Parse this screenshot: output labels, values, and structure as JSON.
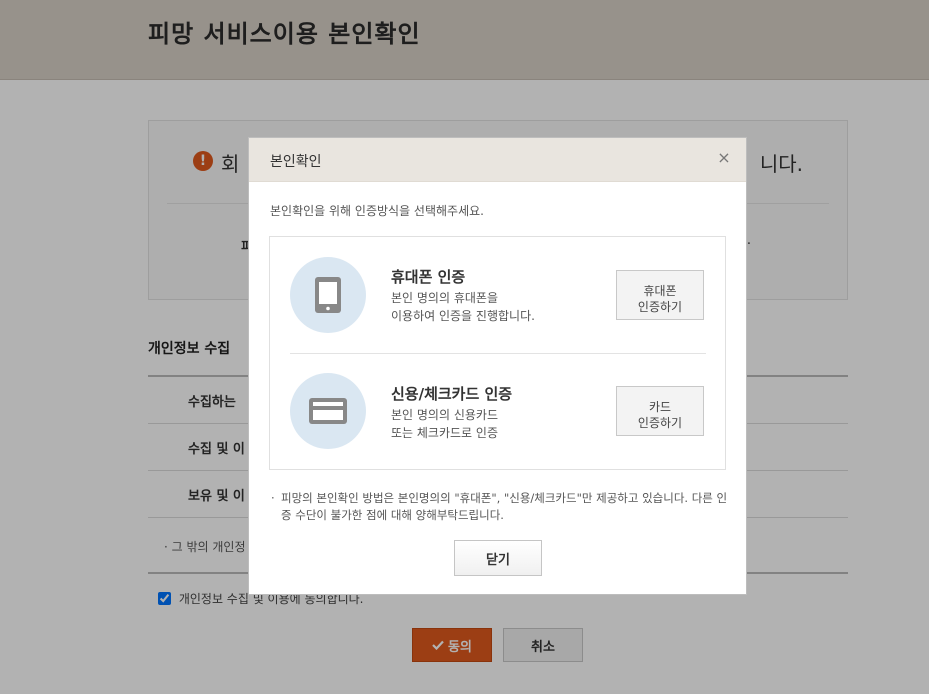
{
  "page": {
    "title": "피망 서비스이용 본인확인",
    "notice_left": "회",
    "notice_right": "니다.",
    "notice_sub_left": "피",
    "notice_sub_right": ".",
    "section_title": "개인정보 수집",
    "rows": [
      {
        "label": "수집하는 "
      },
      {
        "label": "수집 및 이"
      },
      {
        "label": "보유 및 이"
      }
    ],
    "note": "· 그 밖의 개인정",
    "agree_label": "개인정보 수집 및 이용에 동의합니다.",
    "agree_button": "동의",
    "cancel_button": "취소",
    "accent_color": "#e05a1e"
  },
  "modal": {
    "title": "본인확인",
    "close_icon": "×",
    "description": "본인확인을 위해 인증방식을 선택해주세요.",
    "methods": [
      {
        "name": "휴대폰 인증",
        "desc_line1": "본인 명의의 휴대폰을",
        "desc_line2": "이용하여 인증을 진행합니다.",
        "button_line1": "휴대폰",
        "button_line2": "인증하기",
        "icon": "phone-icon"
      },
      {
        "name": "신용/체크카드 인증",
        "desc_line1": "본인 명의의 신용카드",
        "desc_line2": "또는 체크카드로 인증",
        "button_line1": "카드",
        "button_line2": "인증하기",
        "icon": "credit-card-icon"
      }
    ],
    "notice_bullet": "·",
    "notice": "피망의 본인확인 방법은 본인명의의 \"휴대폰\", \"신용/체크카드\"만 제공하고 있습니다. 다른 인증 수단이 불가한 점에 대해 양해부탁드립니다.",
    "close_button": "닫기"
  }
}
